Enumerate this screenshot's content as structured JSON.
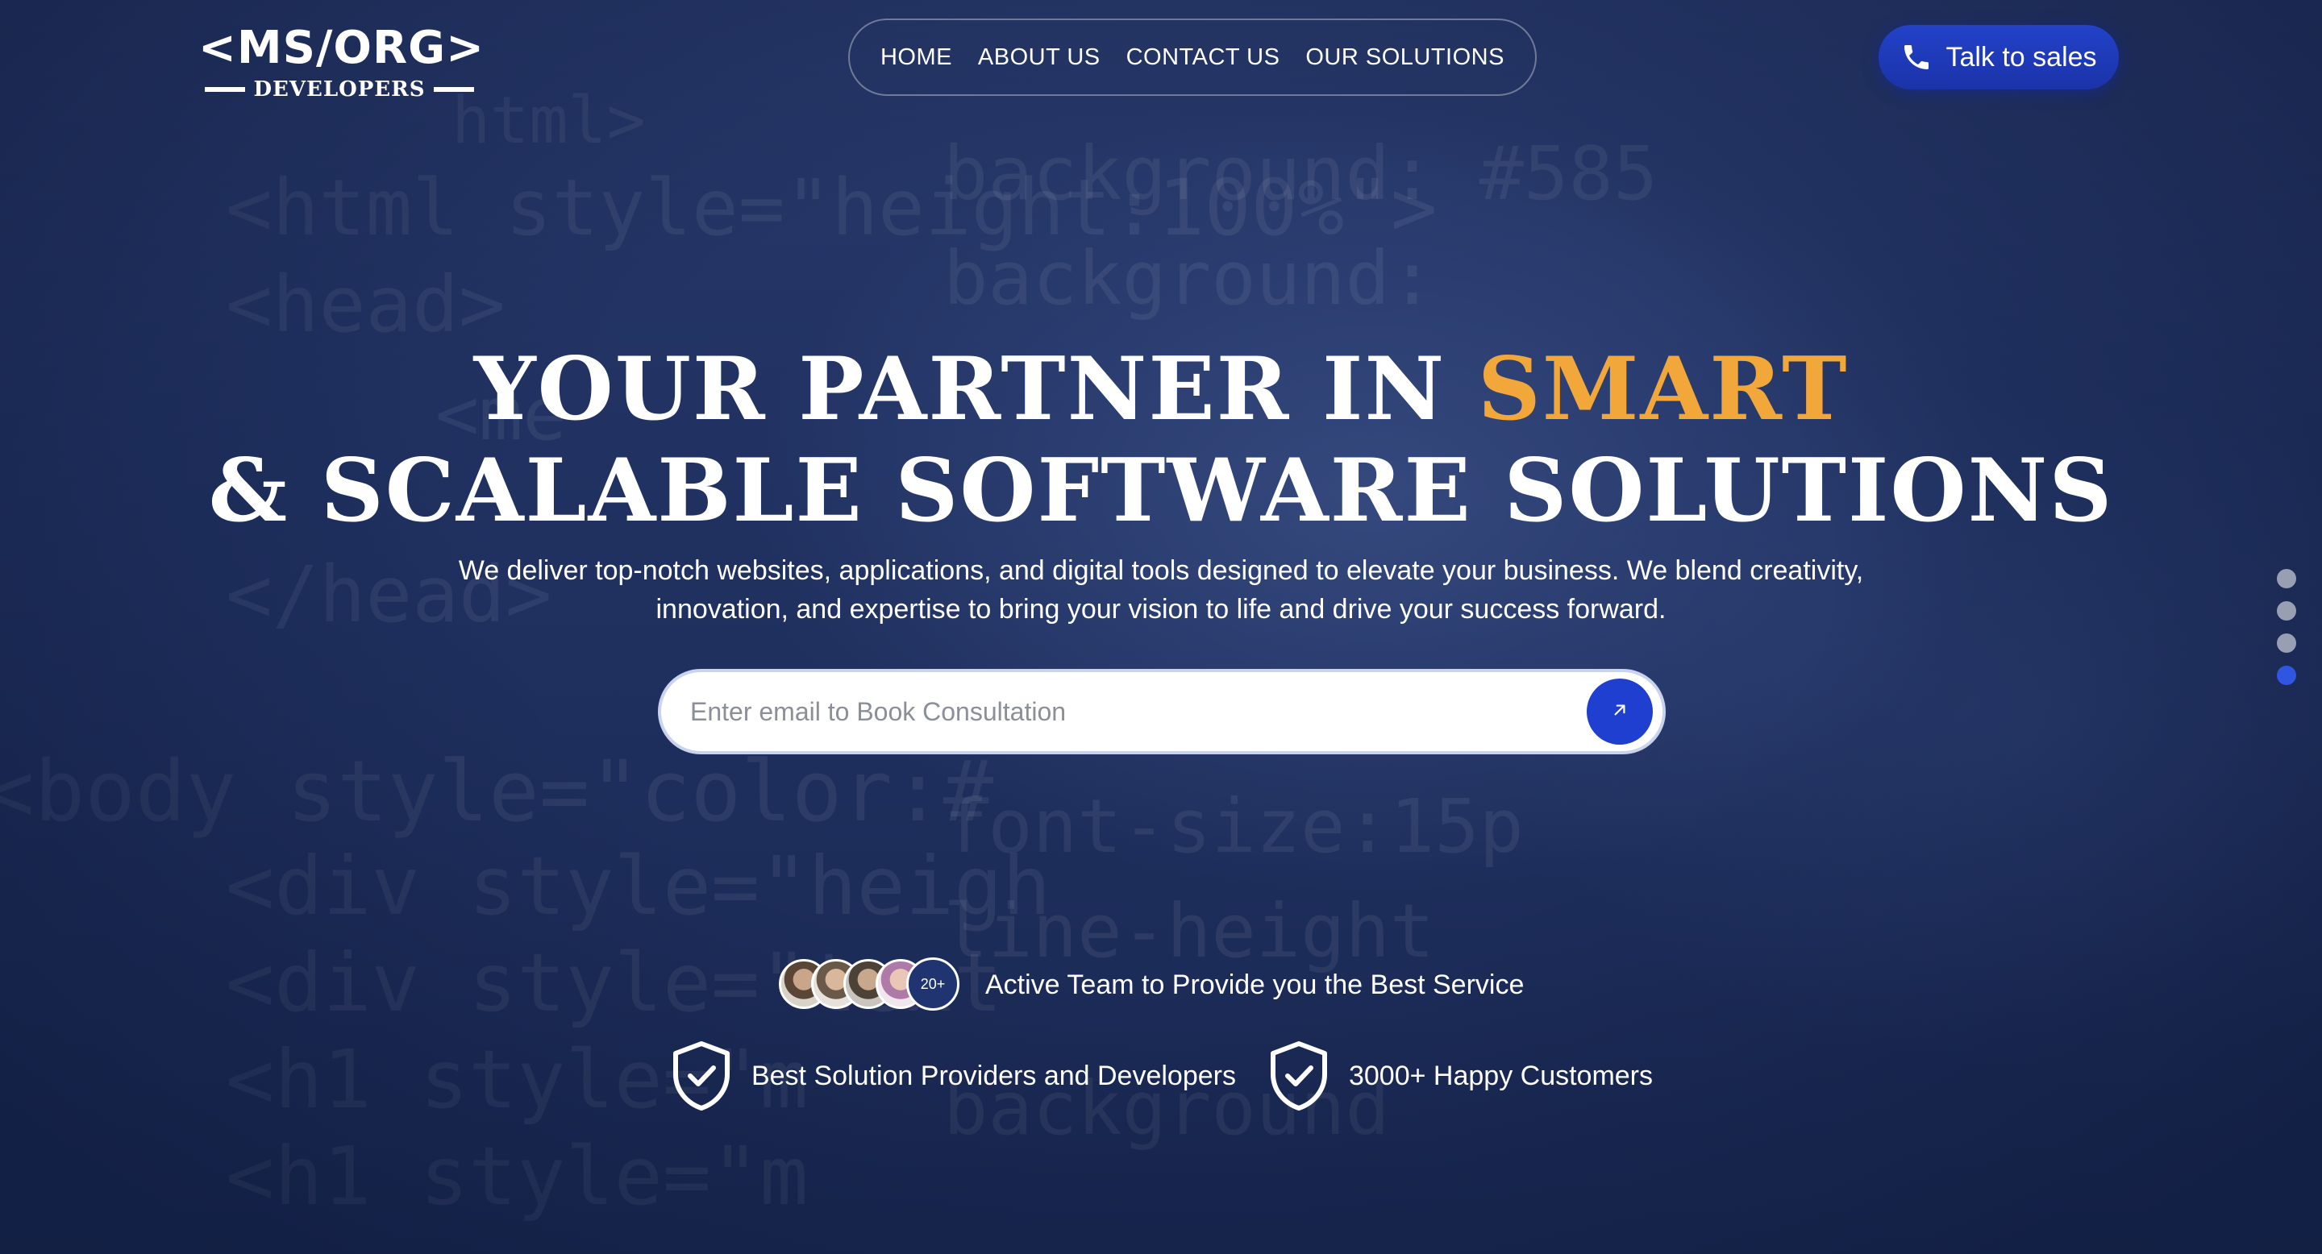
{
  "brand": {
    "logo_mark": "<MS/ORG>",
    "logo_sub": "DEVELOPERS"
  },
  "nav": {
    "items": [
      {
        "label": "HOME"
      },
      {
        "label": "ABOUT US"
      },
      {
        "label": "CONTACT US"
      },
      {
        "label": "OUR SOLUTIONS"
      }
    ]
  },
  "cta": {
    "label": "Talk to sales",
    "icon": "phone-icon"
  },
  "hero": {
    "title_line1_pre": "YOUR PARTNER IN ",
    "title_line1_accent": "SMART",
    "title_line2": "& SCALABLE SOFTWARE SOLUTIONS",
    "subtitle": "We deliver top-notch websites, applications, and digital tools designed to elevate your business. We blend creativity, innovation, and expertise to bring your vision to life and drive your success forward.",
    "accent_color": "#f2a73b"
  },
  "consultation": {
    "placeholder": "Enter email to Book Consultation",
    "value": "",
    "submit_icon": "arrow-up-right-icon",
    "button_color": "#1f3fd0"
  },
  "team": {
    "count_badge": "20+",
    "text": "Active Team to Provide you the Best Service"
  },
  "features": [
    {
      "icon": "shield-check-icon",
      "text": "Best Solution Providers and Developers"
    },
    {
      "icon": "shield-check-icon",
      "text": "3000+ Happy Customers"
    }
  ],
  "slider": {
    "total": 4,
    "active_index": 3,
    "active_color": "#2f56e0"
  },
  "background_code": [
    "html>",
    "<html style=\"height:100%\">",
    "<head>",
    "<me",
    "</head>",
    "<body style=\"color:#",
    "<div style=\"heigh",
    "<div style=\"text",
    "<h1 style=\"m",
    "<h1 style=\"m",
    "background: #585",
    "background:",
    "font-size:15p",
    "line-height",
    "background"
  ]
}
